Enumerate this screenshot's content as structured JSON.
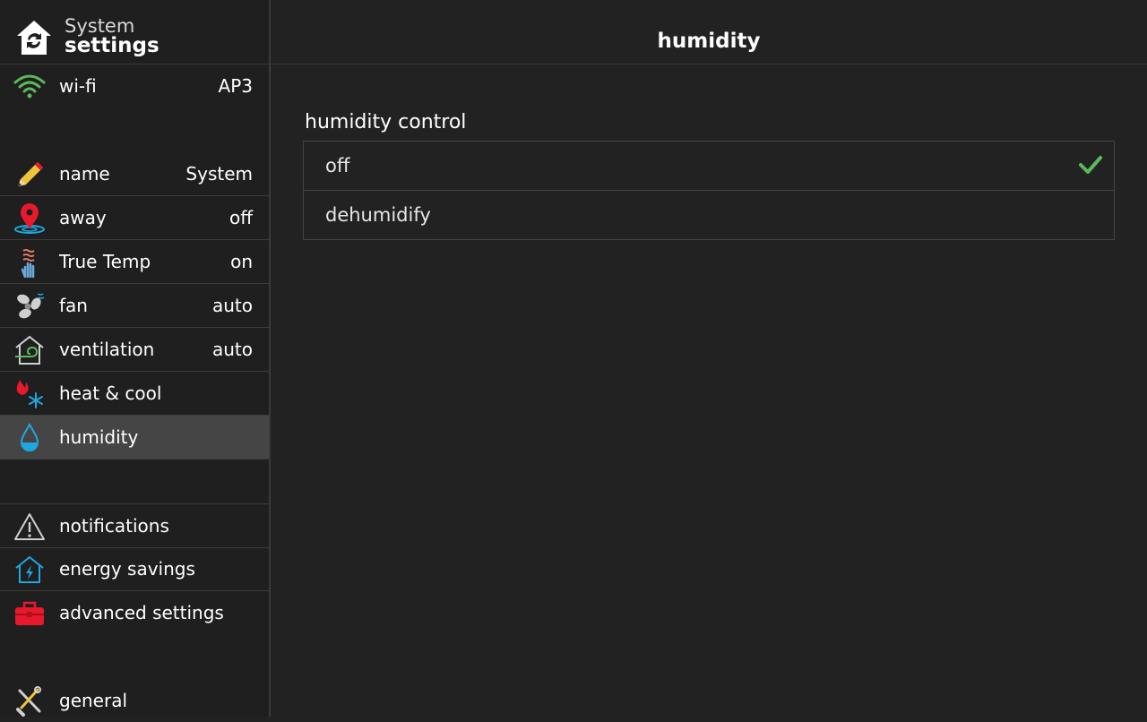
{
  "sidebar": {
    "header": {
      "line1": "System",
      "line2": "settings",
      "icon": "home-logo-icon"
    },
    "items": [
      {
        "id": "wifi",
        "label": "wi-fi",
        "value": "AP3",
        "icon": "wifi-icon"
      },
      {
        "id": "name",
        "label": "name",
        "value": "System",
        "icon": "pencil-icon"
      },
      {
        "id": "away",
        "label": "away",
        "value": "off",
        "icon": "location-pin-icon"
      },
      {
        "id": "truetemp",
        "label": "True Temp",
        "value": "on",
        "icon": "hand-heat-icon"
      },
      {
        "id": "fan",
        "label": "fan",
        "value": "auto",
        "icon": "fan-icon"
      },
      {
        "id": "ventilation",
        "label": "ventilation",
        "value": "auto",
        "icon": "house-air-icon"
      },
      {
        "id": "heatcool",
        "label": "heat & cool",
        "icon": "flame-snowflake-icon"
      },
      {
        "id": "humidity",
        "label": "humidity",
        "icon": "water-drop-icon",
        "active": true
      },
      {
        "id": "notifications",
        "label": "notifications",
        "icon": "warning-triangle-icon"
      },
      {
        "id": "energy",
        "label": "energy savings",
        "icon": "house-bolt-icon"
      },
      {
        "id": "advanced",
        "label": "advanced settings",
        "icon": "toolbox-icon"
      },
      {
        "id": "general",
        "label": "general",
        "icon": "tools-icon"
      }
    ]
  },
  "main": {
    "title": "humidity",
    "section_label": "humidity control",
    "options": [
      {
        "label": "off",
        "selected": true
      },
      {
        "label": "dehumidify",
        "selected": false
      }
    ]
  },
  "colors": {
    "background": "#222222",
    "active_row": "#454545",
    "check": "#5cb85c",
    "wifi": "#5cb85c",
    "accent_red": "#e8192c",
    "accent_blue": "#1ea7e0"
  }
}
